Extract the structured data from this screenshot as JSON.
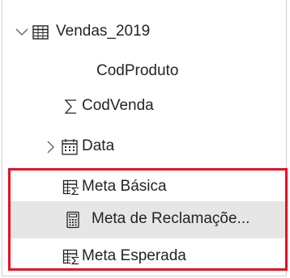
{
  "fields_pane": {
    "table": {
      "name": "Vendas_2019",
      "expanded": true,
      "icon": "table-icon"
    },
    "fields": [
      {
        "label": "CodProduto",
        "icon": "",
        "type": "column"
      },
      {
        "label": "CodVenda",
        "icon": "sigma-icon",
        "type": "aggregate-column"
      },
      {
        "label": "Data",
        "icon": "calendar-icon",
        "type": "date-hierarchy",
        "expandable": true
      },
      {
        "label": "Meta Básica",
        "icon": "measure-table-icon",
        "type": "measure"
      },
      {
        "label": "Meta de Reclamaçõe...",
        "icon": "calculator-icon",
        "type": "measure",
        "highlighted": true
      },
      {
        "label": "Meta Esperada",
        "icon": "measure-table-icon",
        "type": "measure"
      }
    ],
    "highlight_box_color": "#e81123",
    "hover_row_color": "#e6e6e6"
  }
}
